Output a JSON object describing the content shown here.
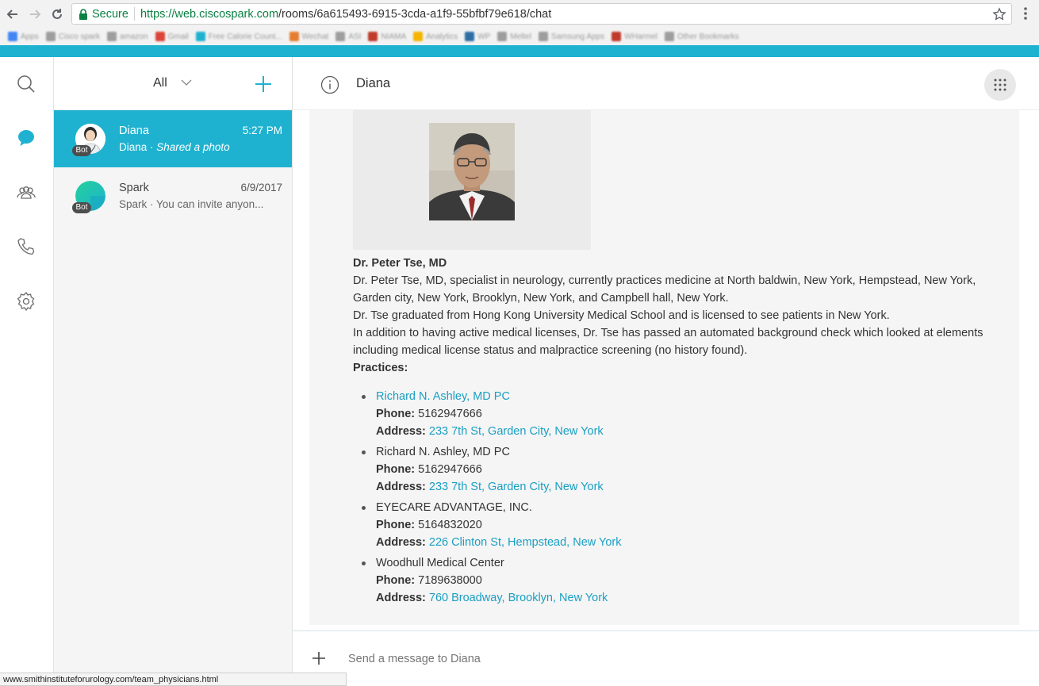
{
  "browser": {
    "secure_label": "Secure",
    "url_scheme_host": "https://web.ciscospark.com",
    "url_path": "/rooms/6a615493-6915-3cda-a1f9-55bfbf79e618/chat",
    "bookmarks": [
      {
        "label": "Apps",
        "color": "#4285f4"
      },
      {
        "label": "Cisco spark",
        "color": "#9e9e9e"
      },
      {
        "label": "amazon",
        "color": "#9e9e9e"
      },
      {
        "label": "Gmail",
        "color": "#db4437"
      },
      {
        "label": "Free Calorie Count...",
        "color": "#1fb2d0"
      },
      {
        "label": "Wechat",
        "color": "#e67c2f"
      },
      {
        "label": "ASI",
        "color": "#9e9e9e"
      },
      {
        "label": "NIAMA",
        "color": "#c0392b"
      },
      {
        "label": "Analytics",
        "color": "#f4b400"
      },
      {
        "label": "WP",
        "color": "#2e6da4"
      },
      {
        "label": "Meltel",
        "color": "#9e9e9e"
      },
      {
        "label": "Samsung Apps",
        "color": "#9e9e9e"
      },
      {
        "label": "WHarmel",
        "color": "#c0392b"
      },
      {
        "label": "Other Bookmarks",
        "color": "#9e9e9e"
      }
    ],
    "status_url": "www.smithinstituteforurology.com/team_physicians.html"
  },
  "colors": {
    "accent": "#1fb2d0",
    "link": "#1a9fc2"
  },
  "rail": {
    "icons": [
      "search-icon",
      "message-icon",
      "people-icon",
      "phone-icon",
      "settings-icon"
    ]
  },
  "roomlist": {
    "filter_label": "All",
    "rooms": [
      {
        "name": "Diana",
        "time": "5:27 PM",
        "preview_sender": "Diana · ",
        "preview_text": "Shared a photo",
        "badge": "Bot",
        "active": true
      },
      {
        "name": "Spark",
        "time": "6/9/2017",
        "preview_sender": "Spark · ",
        "preview_text": "You can invite anyon...",
        "badge": "Bot",
        "active": false
      }
    ]
  },
  "conversation": {
    "title": "Diana",
    "message": {
      "doctor_title": "Dr. Peter Tse, MD",
      "line1": "Dr. Peter Tse, MD, specialist in neurology, currently practices medicine at North baldwin, New York, Hempstead, New York, Garden city, New York, Brooklyn, New York, and Campbell hall, New York.",
      "line2": "Dr. Tse graduated from Hong Kong University Medical School and is licensed to see patients in New York.",
      "line3": "In addition to having active medical licenses, Dr. Tse has passed an automated background check which looked at elements including medical license status and malpractice screening (no history found).",
      "practices_heading": "Practices:",
      "phone_label": "Phone:",
      "address_label": "Address:",
      "practices": [
        {
          "name": "Richard N. Ashley, MD PC",
          "name_is_link": true,
          "phone": "5162947666",
          "address": "233 7th St, Garden City, New York"
        },
        {
          "name": "Richard N. Ashley, MD PC",
          "name_is_link": false,
          "phone": "5162947666",
          "address": "233 7th St, Garden City, New York"
        },
        {
          "name": "EYECARE ADVANTAGE, INC.",
          "name_is_link": false,
          "phone": "5164832020",
          "address": "226 Clinton St, Hempstead, New York"
        },
        {
          "name": "Woodhull Medical Center",
          "name_is_link": false,
          "phone": "7189638000",
          "address": "760 Broadway, Brooklyn, New York"
        }
      ]
    },
    "composer_placeholder": "Send a message to Diana"
  }
}
